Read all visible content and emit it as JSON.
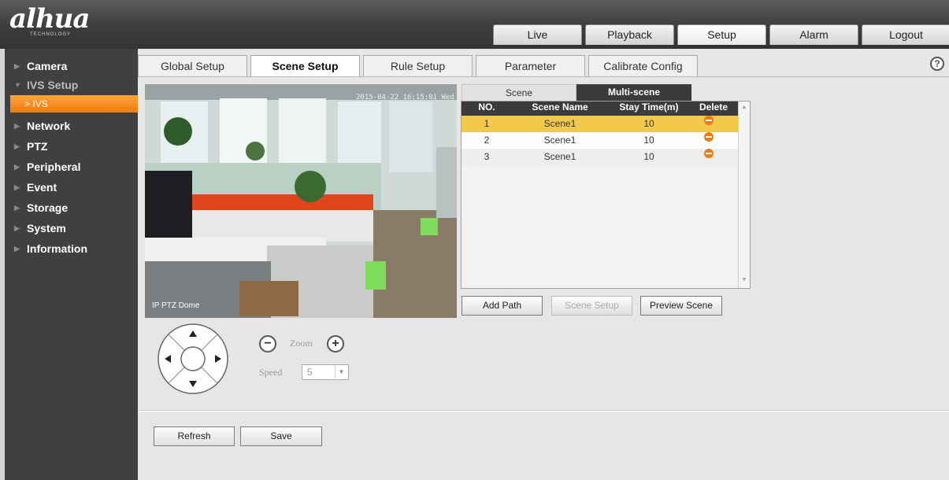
{
  "header": {
    "logo": "alhua",
    "logo_sub": "TECHNOLOGY",
    "nav": [
      "Live",
      "Playback",
      "Setup",
      "Alarm",
      "Logout"
    ],
    "active_nav": "Setup"
  },
  "sidebar": {
    "items": [
      {
        "label": "Camera",
        "state": "collapsed"
      },
      {
        "label": "IVS Setup",
        "state": "expanded"
      },
      {
        "label": "IVS",
        "state": "selected-sub"
      },
      {
        "label": "Network",
        "state": "collapsed"
      },
      {
        "label": "PTZ",
        "state": "collapsed"
      },
      {
        "label": "Peripheral",
        "state": "collapsed"
      },
      {
        "label": "Event",
        "state": "collapsed"
      },
      {
        "label": "Storage",
        "state": "collapsed"
      },
      {
        "label": "System",
        "state": "collapsed"
      },
      {
        "label": "Information",
        "state": "collapsed"
      }
    ]
  },
  "content_tabs": [
    "Global Setup",
    "Scene Setup",
    "Rule Setup",
    "Parameter",
    "Calibrate Config"
  ],
  "active_content_tab": "Scene Setup",
  "help_icon": "?",
  "video": {
    "osd_time": "2015-04-22 16:15:01 Wed",
    "osd_name": "IP PTZ Dome"
  },
  "ptz": {
    "zoom_label": "Zoom",
    "zoom_minus": "−",
    "zoom_plus": "+",
    "speed_label": "Speed",
    "speed_value": "5"
  },
  "scene_tabs": [
    "Scene",
    "Multi-scene"
  ],
  "active_scene_tab": "Multi-scene",
  "table": {
    "columns": [
      "NO.",
      "Scene Name",
      "Stay Time(m)",
      "Delete"
    ],
    "rows": [
      {
        "no": "1",
        "name": "Scene1",
        "stay": "10",
        "selected": true
      },
      {
        "no": "2",
        "name": "Scene1",
        "stay": "10",
        "selected": false
      },
      {
        "no": "3",
        "name": "Scene1",
        "stay": "10",
        "selected": false
      }
    ]
  },
  "table_buttons": {
    "add_path": "Add Path",
    "scene_setup": "Scene Setup",
    "preview_scene": "Preview Scene"
  },
  "footer_buttons": {
    "refresh": "Refresh",
    "save": "Save"
  },
  "colors": {
    "accent_orange": "#f27c0c",
    "selected_row": "#f2c94a",
    "header_dark": "#3b3b3b"
  }
}
